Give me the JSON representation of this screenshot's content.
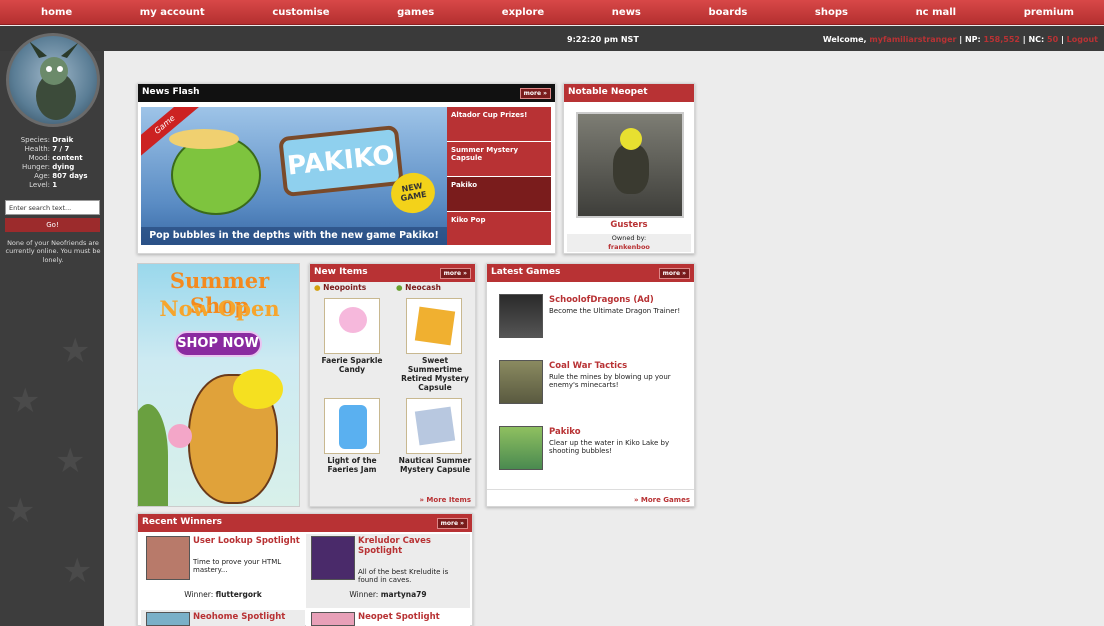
{
  "nav": [
    "home",
    "my account",
    "customise",
    "games",
    "explore",
    "news",
    "boards",
    "shops",
    "nc mall",
    "premium"
  ],
  "infobar": {
    "time": "9:22:20 pm NST",
    "welcome_label": "Welcome,",
    "username": "myfamiliarstranger",
    "np_label": "NP:",
    "np": "158,552",
    "nc_label": "NC:",
    "nc": "50",
    "logout": "Logout"
  },
  "pet": {
    "rows": [
      {
        "k": "Species:",
        "v": "Draik"
      },
      {
        "k": "Health:",
        "v": "7 / 7"
      },
      {
        "k": "Mood:",
        "v": "content"
      },
      {
        "k": "Hunger:",
        "v": "dying"
      },
      {
        "k": "Age:",
        "v": "807 days"
      },
      {
        "k": "Level:",
        "v": "1"
      }
    ]
  },
  "search": {
    "placeholder": "Enter search text...",
    "go": "Go!"
  },
  "friends_text": "None of your Neofriends are currently online. You must be lonely.",
  "newsflash": {
    "title": "News Flash",
    "more": "more »",
    "game_ribbon": "Game",
    "banner_title": "PAKIKO",
    "badge": "NEW GAME",
    "caption": "Pop bubbles in the depths with the new game Pakiko!",
    "items": [
      "Altador Cup Prizes!",
      "Summer Mystery Capsule",
      "Pakiko",
      "Kiko Pop"
    ]
  },
  "notable": {
    "title": "Notable Neopet",
    "name": "Gusters",
    "owned_label": "Owned by:",
    "owner": "frankenboo"
  },
  "summer": {
    "line1": "Summer Shop",
    "line2": "Now Open",
    "button": "SHOP NOW"
  },
  "newitems": {
    "title": "New Items",
    "more": "more »",
    "tab1": "Neopoints",
    "tab2": "Neocash",
    "items": [
      "Faerie Sparkle Candy",
      "Sweet Summertime Retired Mystery Capsule",
      "Light of the Faeries Jam",
      "Nautical Summer Mystery Capsule"
    ],
    "footer": "» More Items"
  },
  "latestgames": {
    "title": "Latest Games",
    "more": "more »",
    "games": [
      {
        "name": "SchoolofDragons (Ad)",
        "desc": "Become the Ultimate Dragon Trainer!"
      },
      {
        "name": "Coal War Tactics",
        "desc": "Rule the mines by blowing up your enemy's minecarts!"
      },
      {
        "name": "Pakiko",
        "desc": "Clear up the water in Kiko Lake by shooting bubbles!"
      }
    ],
    "footer": "» More Games"
  },
  "winners": {
    "title": "Recent Winners",
    "more": "more »",
    "winner_label": "Winner:",
    "cards": [
      {
        "title": "User Lookup Spotlight",
        "desc": "Time to prove your HTML mastery...",
        "winner": "fluttergork"
      },
      {
        "title": "Kreludor Caves Spotlight",
        "desc": "All of the best Kreludite is found in caves.",
        "winner": "martyna79"
      },
      {
        "title": "Neohome Spotlight"
      },
      {
        "title": "Neopet Spotlight"
      }
    ]
  },
  "colors": {
    "accent": "#b83234",
    "nav": "#c93d3e",
    "sidebar": "#3d3d3d"
  }
}
